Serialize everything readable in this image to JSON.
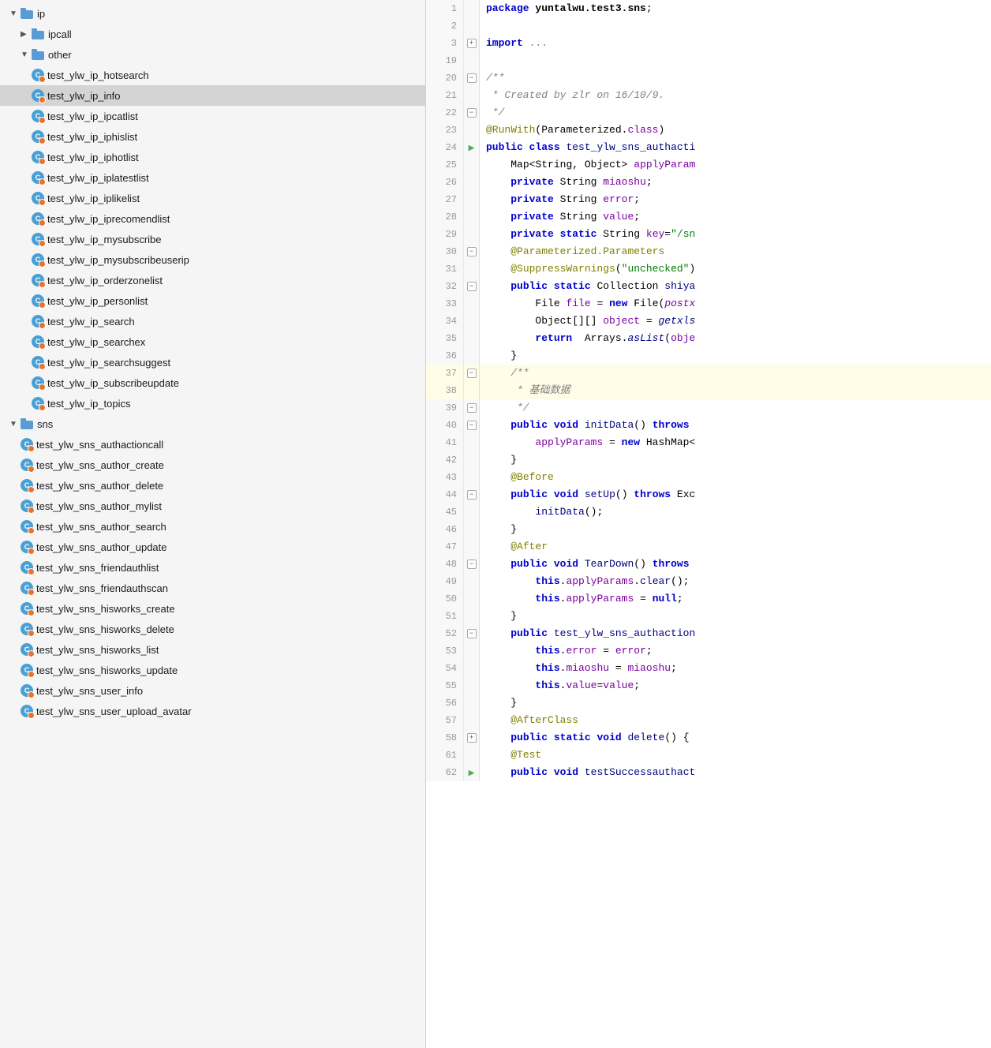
{
  "fileTree": {
    "sections": [
      {
        "name": "ip",
        "type": "folder",
        "expanded": true,
        "indent": 0,
        "children": [
          {
            "name": "ipcall",
            "type": "folder",
            "expanded": false,
            "indent": 1
          },
          {
            "name": "other",
            "type": "folder",
            "expanded": true,
            "indent": 1,
            "children": [
              {
                "name": "test_ylw_ip_hotsearch",
                "type": "test",
                "indent": 2
              },
              {
                "name": "test_ylw_ip_info",
                "type": "test",
                "indent": 2,
                "selected": true
              },
              {
                "name": "test_ylw_ip_ipcatlist",
                "type": "test",
                "indent": 2
              },
              {
                "name": "test_ylw_ip_iphislist",
                "type": "test",
                "indent": 2
              },
              {
                "name": "test_ylw_ip_iphotlist",
                "type": "test",
                "indent": 2
              },
              {
                "name": "test_ylw_ip_iplatestlist",
                "type": "test",
                "indent": 2
              },
              {
                "name": "test_ylw_ip_iplikelist",
                "type": "test",
                "indent": 2
              },
              {
                "name": "test_ylw_ip_iprecomendlist",
                "type": "test",
                "indent": 2
              },
              {
                "name": "test_ylw_ip_mysubscribe",
                "type": "test",
                "indent": 2
              },
              {
                "name": "test_ylw_ip_mysubscribeuserip",
                "type": "test",
                "indent": 2
              },
              {
                "name": "test_ylw_ip_orderzonelist",
                "type": "test",
                "indent": 2
              },
              {
                "name": "test_ylw_ip_personlist",
                "type": "test",
                "indent": 2
              },
              {
                "name": "test_ylw_ip_search",
                "type": "test",
                "indent": 2
              },
              {
                "name": "test_ylw_ip_searchex",
                "type": "test",
                "indent": 2
              },
              {
                "name": "test_ylw_ip_searchsuggest",
                "type": "test",
                "indent": 2
              },
              {
                "name": "test_ylw_ip_subscribeupdate",
                "type": "test",
                "indent": 2
              },
              {
                "name": "test_ylw_ip_topics",
                "type": "test",
                "indent": 2
              }
            ]
          }
        ]
      },
      {
        "name": "sns",
        "type": "folder",
        "expanded": true,
        "indent": 0,
        "children": [
          {
            "name": "test_ylw_sns_authactioncall",
            "type": "test",
            "indent": 1
          },
          {
            "name": "test_ylw_sns_author_create",
            "type": "test",
            "indent": 1
          },
          {
            "name": "test_ylw_sns_author_delete",
            "type": "test",
            "indent": 1
          },
          {
            "name": "test_ylw_sns_author_mylist",
            "type": "test",
            "indent": 1
          },
          {
            "name": "test_ylw_sns_author_search",
            "type": "test",
            "indent": 1
          },
          {
            "name": "test_ylw_sns_author_update",
            "type": "test",
            "indent": 1
          },
          {
            "name": "test_ylw_sns_friendauthlist",
            "type": "test",
            "indent": 1
          },
          {
            "name": "test_ylw_sns_friendauthscan",
            "type": "test",
            "indent": 1
          },
          {
            "name": "test_ylw_sns_hisworks_create",
            "type": "test",
            "indent": 1
          },
          {
            "name": "test_ylw_sns_hisworks_delete",
            "type": "test",
            "indent": 1
          },
          {
            "name": "test_ylw_sns_hisworks_list",
            "type": "test",
            "indent": 1
          },
          {
            "name": "test_ylw_sns_hisworks_update",
            "type": "test",
            "indent": 1
          },
          {
            "name": "test_ylw_sns_user_info",
            "type": "test",
            "indent": 1
          },
          {
            "name": "test_ylw_sns_user_upload_avatar",
            "type": "test",
            "indent": 1
          }
        ]
      }
    ]
  },
  "codeLines": [
    {
      "num": 1,
      "content": "package yuntalwu.test3.sns;"
    },
    {
      "num": 2,
      "content": ""
    },
    {
      "num": 3,
      "content": "import ...",
      "hasGutter": "plus"
    },
    {
      "num": 19,
      "content": ""
    },
    {
      "num": 20,
      "content": "/**",
      "hasGutter": "minus"
    },
    {
      "num": 21,
      "content": " * Created by zlr on 16/10/9."
    },
    {
      "num": 22,
      "content": " */",
      "hasGutter": "minus"
    },
    {
      "num": 23,
      "content": "@RunWith(Parameterized.class)"
    },
    {
      "num": 24,
      "content": "public class test_ylw_sns_authacti",
      "hasRun": true
    },
    {
      "num": 25,
      "content": "    Map<String, Object> applyParam"
    },
    {
      "num": 26,
      "content": "    private String miaoshu;"
    },
    {
      "num": 27,
      "content": "    private String error;"
    },
    {
      "num": 28,
      "content": "    private String value;"
    },
    {
      "num": 29,
      "content": "    private static String key=\"/sn"
    },
    {
      "num": 30,
      "content": "    @Parameterized.Parameters",
      "hasGutter": "minus"
    },
    {
      "num": 31,
      "content": "    @SuppressWarnings(\"unchecked\")"
    },
    {
      "num": 32,
      "content": "    public static Collection shiya",
      "hasGutter": "minus"
    },
    {
      "num": 33,
      "content": "        File file = new File(postx"
    },
    {
      "num": 34,
      "content": "        Object[][] object = getxls"
    },
    {
      "num": 35,
      "content": "        return  Arrays.asList(obje"
    },
    {
      "num": 36,
      "content": "    }"
    },
    {
      "num": 37,
      "content": "    /**",
      "hasGutter": "minus",
      "highlight": true
    },
    {
      "num": 38,
      "content": "     * 基础数据",
      "highlight": true
    },
    {
      "num": 39,
      "content": "     */",
      "hasGutter": "minus"
    },
    {
      "num": 40,
      "content": "    public void initData() throws",
      "hasGutter": "minus"
    },
    {
      "num": 41,
      "content": "        applyParams = new HashMap<"
    },
    {
      "num": 42,
      "content": "    }"
    },
    {
      "num": 43,
      "content": "    @Before"
    },
    {
      "num": 44,
      "content": "    public void setUp() throws Exc",
      "hasGutter": "minus"
    },
    {
      "num": 45,
      "content": "        initData();"
    },
    {
      "num": 46,
      "content": "    }"
    },
    {
      "num": 47,
      "content": "    @After"
    },
    {
      "num": 48,
      "content": "    public void TearDown() throws",
      "hasGutter": "minus"
    },
    {
      "num": 49,
      "content": "        this.applyParams.clear();"
    },
    {
      "num": 50,
      "content": "        this.applyParams = null;"
    },
    {
      "num": 51,
      "content": "    }"
    },
    {
      "num": 52,
      "content": "    public test_ylw_sns_authaction",
      "hasGutter": "minus"
    },
    {
      "num": 53,
      "content": "        this.error = error;"
    },
    {
      "num": 54,
      "content": "        this.miaoshu = miaoshu;"
    },
    {
      "num": 55,
      "content": "        this.value=value;"
    },
    {
      "num": 56,
      "content": "    }"
    },
    {
      "num": 57,
      "content": "    @AfterClass"
    },
    {
      "num": 58,
      "content": "    public static void delete() {",
      "hasGutter": "plus"
    },
    {
      "num": 61,
      "content": "    @Test"
    },
    {
      "num": 62,
      "content": "    public void testSuccessauthact",
      "hasRun": true
    }
  ]
}
